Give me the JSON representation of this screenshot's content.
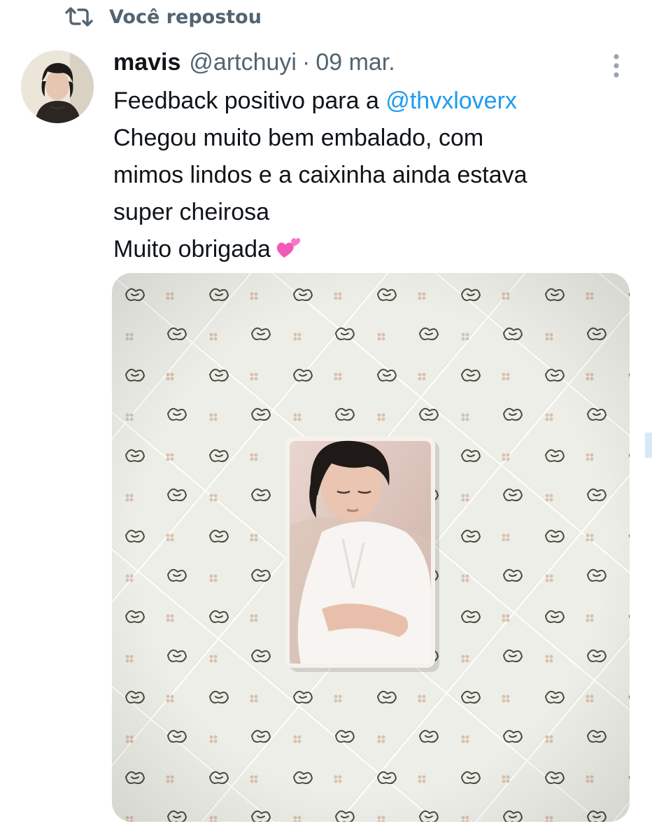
{
  "repost": {
    "icon": "repost-icon",
    "label": "Você repostou"
  },
  "tweet": {
    "author": {
      "display_name": "mavis",
      "handle": "@artchuyi",
      "separator": "·",
      "date": "09 mar.",
      "avatar": "profile-photo"
    },
    "more_icon": "more-vertical-icon",
    "text": {
      "line1_prefix": "Feedback positivo para a ",
      "mention": "@thvxloverx",
      "line2": "Chegou muito bem embalado, com",
      "line3": "mimos lindos e a caixinha ainda estava",
      "line4": "super cheirosa",
      "line5": "Muito obrigada",
      "emoji": "two-hearts"
    },
    "media": {
      "description_icon": "photo-quilt-photocard"
    }
  },
  "colors": {
    "text_primary": "#0f1419",
    "text_secondary": "#536471",
    "link": "#1d9bf0",
    "background": "#ffffff"
  }
}
